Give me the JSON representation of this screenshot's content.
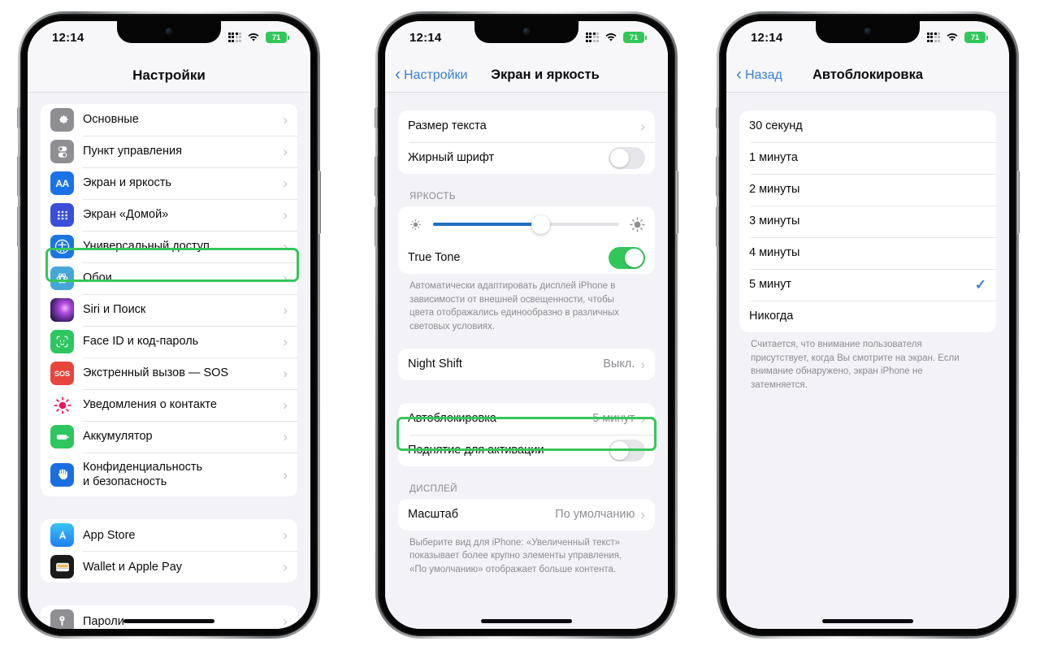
{
  "status_bar": {
    "time": "12:14",
    "battery_level": "71",
    "icons": [
      "cellular-signal-icon",
      "wifi-icon",
      "battery-icon"
    ]
  },
  "colors": {
    "highlight_green": "#35c75a",
    "toggle_on_green": "#33c75a",
    "accent_blue": "#3a7fd5",
    "slider_blue": "#1f6fc4",
    "screen_bg": "#f2f2f7",
    "card_bg": "#ffffff",
    "secondary_text": "#8c8c92"
  },
  "phone1": {
    "nav": {
      "title": "Настройки"
    },
    "groups": [
      {
        "rows": [
          {
            "label": "Основные",
            "icon": "gear-icon",
            "icon_class": "g-gear",
            "accessory": "chevron"
          },
          {
            "label": "Пункт управления",
            "icon": "control-center-icon",
            "icon_class": "g-cc",
            "accessory": "chevron"
          },
          {
            "label": "Экран и яркость",
            "icon": "display-brightness-icon",
            "icon_class": "g-aa",
            "glyph": "AA",
            "accessory": "chevron",
            "highlighted": true
          },
          {
            "label": "Экран «Домой»",
            "icon": "home-screen-icon",
            "icon_class": "g-home",
            "accessory": "chevron"
          },
          {
            "label": "Универсальный доступ",
            "icon": "accessibility-icon",
            "icon_class": "g-acc",
            "accessory": "chevron"
          },
          {
            "label": "Обои",
            "icon": "wallpaper-icon",
            "icon_class": "g-wall",
            "accessory": "chevron"
          },
          {
            "label": "Siri и Поиск",
            "icon": "siri-icon",
            "icon_class": "g-siri",
            "accessory": "chevron"
          },
          {
            "label": "Face ID и код-пароль",
            "icon": "face-id-icon",
            "icon_class": "g-face",
            "accessory": "chevron"
          },
          {
            "label": "Экстренный вызов — SOS",
            "icon": "sos-icon",
            "icon_class": "g-sos",
            "glyph": "SOS",
            "accessory": "chevron"
          },
          {
            "label": "Уведомления о контакте",
            "icon": "contact-notification-icon",
            "icon_class": "g-notif",
            "accessory": "chevron"
          },
          {
            "label": "Аккумулятор",
            "icon": "battery-settings-icon",
            "icon_class": "g-batt",
            "accessory": "chevron"
          },
          {
            "label": "Конфиденциальность\nи безопасность",
            "icon": "privacy-hand-icon",
            "icon_class": "g-priv",
            "accessory": "chevron"
          }
        ]
      },
      {
        "rows": [
          {
            "label": "App Store",
            "icon": "app-store-icon",
            "icon_class": "g-appst",
            "accessory": "chevron"
          },
          {
            "label": "Wallet и Apple Pay",
            "icon": "wallet-icon",
            "icon_class": "g-wallet",
            "accessory": "chevron"
          }
        ]
      },
      {
        "rows": [
          {
            "label": "Пароли",
            "icon": "passwords-key-icon",
            "icon_class": "g-pass",
            "accessory": "chevron"
          }
        ]
      }
    ]
  },
  "phone2": {
    "nav": {
      "back_label": "Настройки",
      "title": "Экран и яркость"
    },
    "text_group": {
      "rows": [
        {
          "label": "Размер текста",
          "accessory": "chevron"
        },
        {
          "label": "Жирный шрифт",
          "accessory": "toggle",
          "toggle_state": "off"
        }
      ]
    },
    "brightness": {
      "section_header": "ЯРКОСТЬ",
      "slider": {
        "name": "brightness-slider",
        "value_percent": 58,
        "left_icon": "sun-small-icon",
        "right_icon": "sun-large-icon"
      },
      "true_tone": {
        "label": "True Tone",
        "toggle_state": "on"
      },
      "footnote": "Автоматически адаптировать дисплей iPhone в\nзависимости от внешней освещенности, чтобы\nцвета отображались единообразно в различных\nсветовых условиях."
    },
    "night_shift": {
      "label": "Night Shift",
      "value": "Выкл.",
      "accessory": "chevron"
    },
    "autolock_group": {
      "rows": [
        {
          "label": "Автоблокировка",
          "value": "5 минут",
          "accessory": "chevron",
          "highlighted": true
        },
        {
          "label": "Поднятие для активации",
          "accessory": "toggle",
          "toggle_state": "off"
        }
      ]
    },
    "display_section": {
      "section_header": "ДИСПЛЕЙ",
      "rows": [
        {
          "label": "Масштаб",
          "value": "По умолчанию",
          "accessory": "chevron"
        }
      ],
      "footnote": "Выберите вид для iPhone: «Увеличенный текст»\nпоказывает более крупно элементы управления,\n«По умолчанию» отображает больше контента."
    }
  },
  "phone3": {
    "nav": {
      "back_label": "Назад",
      "title": "Автоблокировка"
    },
    "options": [
      {
        "label": "30 секунд",
        "selected": false
      },
      {
        "label": "1 минута",
        "selected": false
      },
      {
        "label": "2 минуты",
        "selected": false
      },
      {
        "label": "3 минуты",
        "selected": false
      },
      {
        "label": "4 минуты",
        "selected": false
      },
      {
        "label": "5 минут",
        "selected": true
      },
      {
        "label": "Никогда",
        "selected": false
      }
    ],
    "footnote": "Считается, что внимание пользователя\nприсутствует, когда Вы смотрите на экран. Если\nвнимание обнаружено, экран iPhone не\nзатемняется."
  }
}
